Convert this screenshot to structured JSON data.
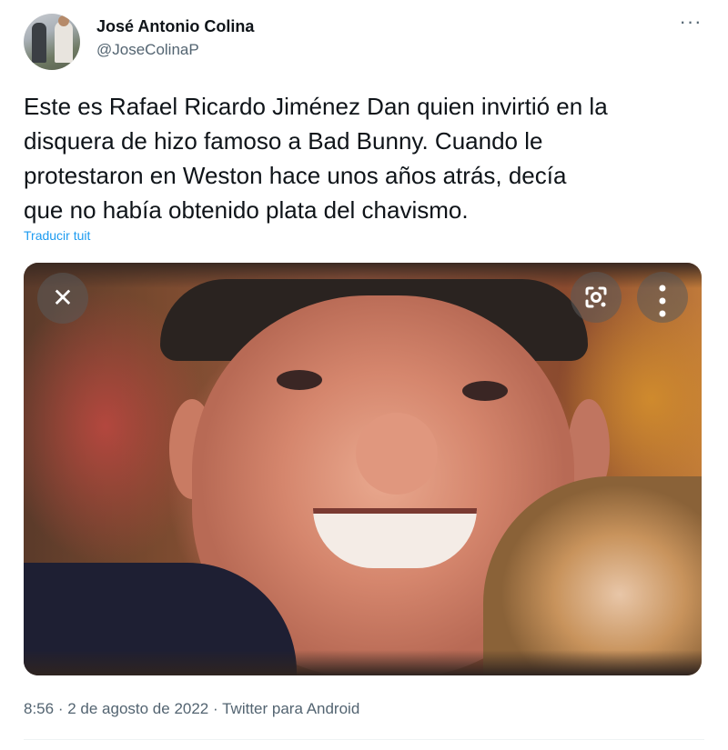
{
  "author": {
    "name": "José Antonio Colina",
    "handle": "@JoseColinaP"
  },
  "tweet": {
    "lines": [
      "Este es Rafael Ricardo Jiménez Dan quien invirtió en la",
      "disquera de hizo famoso a Bad Bunny. Cuando le",
      "protestaron en Weston hace unos años atrás, decía",
      "que no había obtenido plata del chavismo."
    ],
    "translate_label": "Traducir tuit"
  },
  "media": {
    "close_icon": "close-icon",
    "lens_icon": "google-lens-icon",
    "more_icon": "vertical-ellipsis-icon"
  },
  "meta": {
    "time": "8:56",
    "date": "2 de agosto de 2022",
    "separator": "·",
    "source": "Twitter para Android"
  },
  "more_label": "···",
  "colors": {
    "link": "#1d9bf0",
    "secondary_text": "#536471",
    "primary_text": "#0f1419"
  }
}
